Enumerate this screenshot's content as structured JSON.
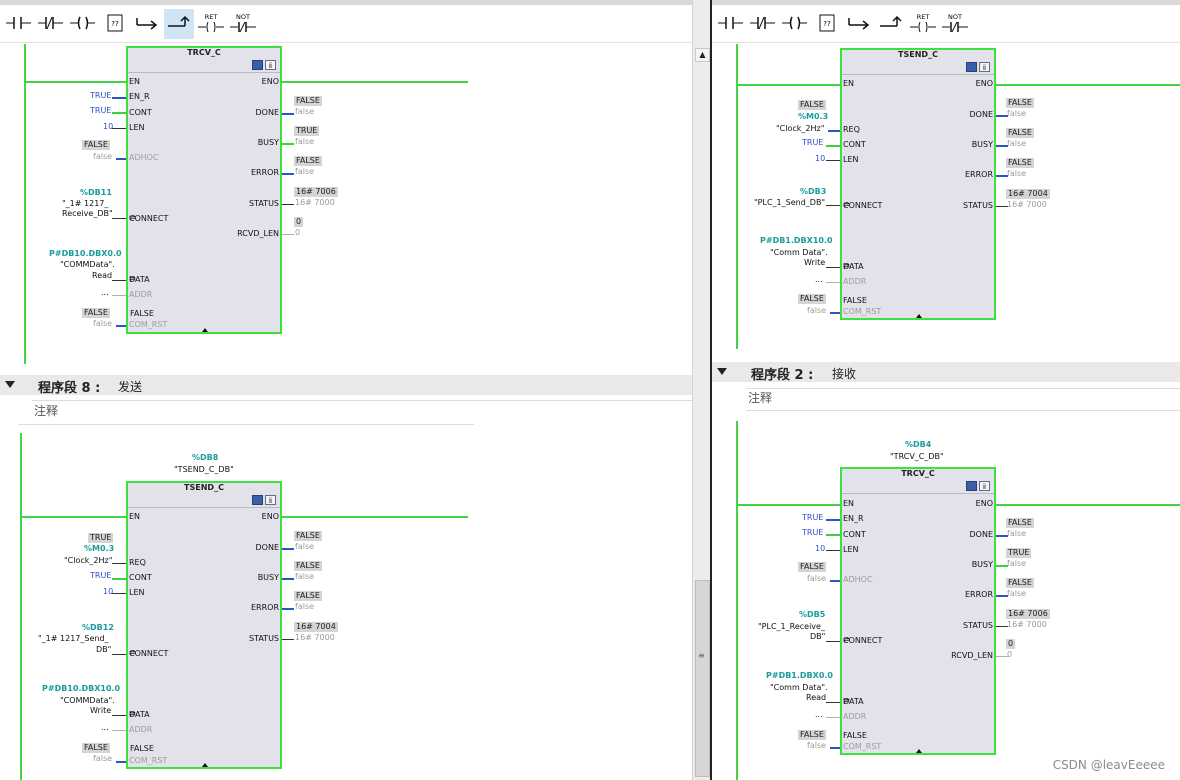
{
  "toolbar": {
    "buttons": [
      {
        "name": "contact-no-button"
      },
      {
        "name": "contact-nc-button"
      },
      {
        "name": "coil-button"
      },
      {
        "name": "empty-box-button",
        "text": "??"
      },
      {
        "name": "open-branch-button"
      },
      {
        "name": "close-branch-button"
      },
      {
        "name": "return-button",
        "text": "RET"
      },
      {
        "name": "not-button",
        "text": "NOT"
      }
    ]
  },
  "left": {
    "trcv": {
      "title": "TRCV_C",
      "pins_in": [
        "EN",
        "EN_R",
        "CONT",
        "LEN",
        "ADHOC",
        "CONNECT",
        "DATA",
        "ADDR",
        "COM_RST"
      ],
      "pins_out": [
        "ENO",
        "DONE",
        "BUSY",
        "ERROR",
        "STATUS",
        "RCVD_LEN"
      ],
      "en_r_val": "TRUE",
      "cont_val": "TRUE",
      "len_val": "10",
      "adhoc_box": "FALSE",
      "adhoc_val": "false",
      "connect_db": "%DB11",
      "connect_name1": "\"_1# 1217_",
      "connect_name2": "Receive_DB\"",
      "data_ptr": "P#DB10.DBX0.0",
      "data_name1": "\"COMMData\".",
      "data_name2": "Read",
      "addr_val": "...",
      "com_rst_box": "FALSE",
      "com_rst_val": "false",
      "com_rst_inner": "FALSE",
      "done_box": "FALSE",
      "done_val": "false",
      "busy_box": "TRUE",
      "busy_val": "false",
      "error_box": "FALSE",
      "error_val": "false",
      "status_box": "16# 7006",
      "status_val": "16# 7000",
      "rcvd_box": "0",
      "rcvd_val": "0"
    },
    "segment": {
      "name": "程序段 8 :",
      "title": "发送",
      "comment": "注释"
    },
    "tsend": {
      "db": "%DB8",
      "db_name": "\"TSEND_C_DB\"",
      "title": "TSEND_C",
      "pins_in": [
        "EN",
        "REQ",
        "CONT",
        "LEN",
        "CONNECT",
        "DATA",
        "ADDR",
        "COM_RST"
      ],
      "pins_out": [
        "ENO",
        "DONE",
        "BUSY",
        "ERROR",
        "STATUS"
      ],
      "req_box": "TRUE",
      "req_tag": "%M0.3",
      "req_name": "\"Clock_2Hz\"",
      "cont_val": "TRUE",
      "len_val": "10",
      "connect_db": "%DB12",
      "connect_name1": "\"_1# 1217_Send_",
      "connect_name2": "DB\"",
      "data_ptr": "P#DB10.DBX10.0",
      "data_name1": "\"COMMData\".",
      "data_name2": "Write",
      "addr_val": "...",
      "com_rst_box": "FALSE",
      "com_rst_val": "false",
      "com_rst_inner": "FALSE",
      "done_box": "FALSE",
      "done_val": "false",
      "busy_box": "FALSE",
      "busy_val": "false",
      "error_box": "FALSE",
      "error_val": "false",
      "status_box": "16# 7004",
      "status_val": "16# 7000"
    }
  },
  "right": {
    "tsend": {
      "title": "TSEND_C",
      "pins_in": [
        "EN",
        "REQ",
        "CONT",
        "LEN",
        "CONNECT",
        "DATA",
        "ADDR",
        "COM_RST"
      ],
      "pins_out": [
        "ENO",
        "DONE",
        "BUSY",
        "ERROR",
        "STATUS"
      ],
      "req_box": "FALSE",
      "req_tag": "%M0.3",
      "req_name": "\"Clock_2Hz\"",
      "cont_val": "TRUE",
      "len_val": "10",
      "connect_db": "%DB3",
      "connect_name1": "\"PLC_1_Send_DB\"",
      "data_ptr": "P#DB1.DBX10.0",
      "data_name1": "\"Comm Data\".",
      "data_name2": "Write",
      "addr_val": "...",
      "com_rst_box": "FALSE",
      "com_rst_val": "false",
      "com_rst_inner": "FALSE",
      "done_box": "FALSE",
      "done_val": "false",
      "busy_box": "FALSE",
      "busy_val": "false",
      "error_box": "FALSE",
      "error_val": "false",
      "status_box": "16# 7004",
      "status_val": "16# 7000"
    },
    "segment": {
      "name": "程序段 2 :",
      "title": "接收",
      "comment": "注释"
    },
    "trcv": {
      "db": "%DB4",
      "db_name": "\"TRCV_C_DB\"",
      "title": "TRCV_C",
      "pins_in": [
        "EN",
        "EN_R",
        "CONT",
        "LEN",
        "ADHOC",
        "CONNECT",
        "DATA",
        "ADDR",
        "COM_RST"
      ],
      "pins_out": [
        "ENO",
        "DONE",
        "BUSY",
        "ERROR",
        "STATUS",
        "RCVD_LEN"
      ],
      "en_r_val": "TRUE",
      "cont_val": "TRUE",
      "len_val": "10",
      "adhoc_box": "FALSE",
      "adhoc_val": "false",
      "connect_db": "%DB5",
      "connect_name1": "\"PLC_1_Receive_",
      "connect_name2": "DB\"",
      "data_ptr": "P#DB1.DBX0.0",
      "data_name1": "\"Comm Data\".",
      "data_name2": "Read",
      "addr_val": "...",
      "com_rst_box": "FALSE",
      "com_rst_val": "false",
      "com_rst_inner": "FALSE",
      "done_box": "FALSE",
      "done_val": "false",
      "busy_box": "TRUE",
      "busy_val": "false",
      "error_box": "FALSE",
      "error_val": "false",
      "status_box": "16# 7006",
      "status_val": "16# 7000",
      "rcvd_box": "0",
      "rcvd_val": "0"
    }
  },
  "watermark": "CSDN @leavEeeee",
  "colors": {
    "wire": "#44d244",
    "box_border": "#3fdf3f",
    "box_fill": "#e2e3ea",
    "bool_true": "#2d51c9",
    "tag": "#1b9c9a"
  }
}
